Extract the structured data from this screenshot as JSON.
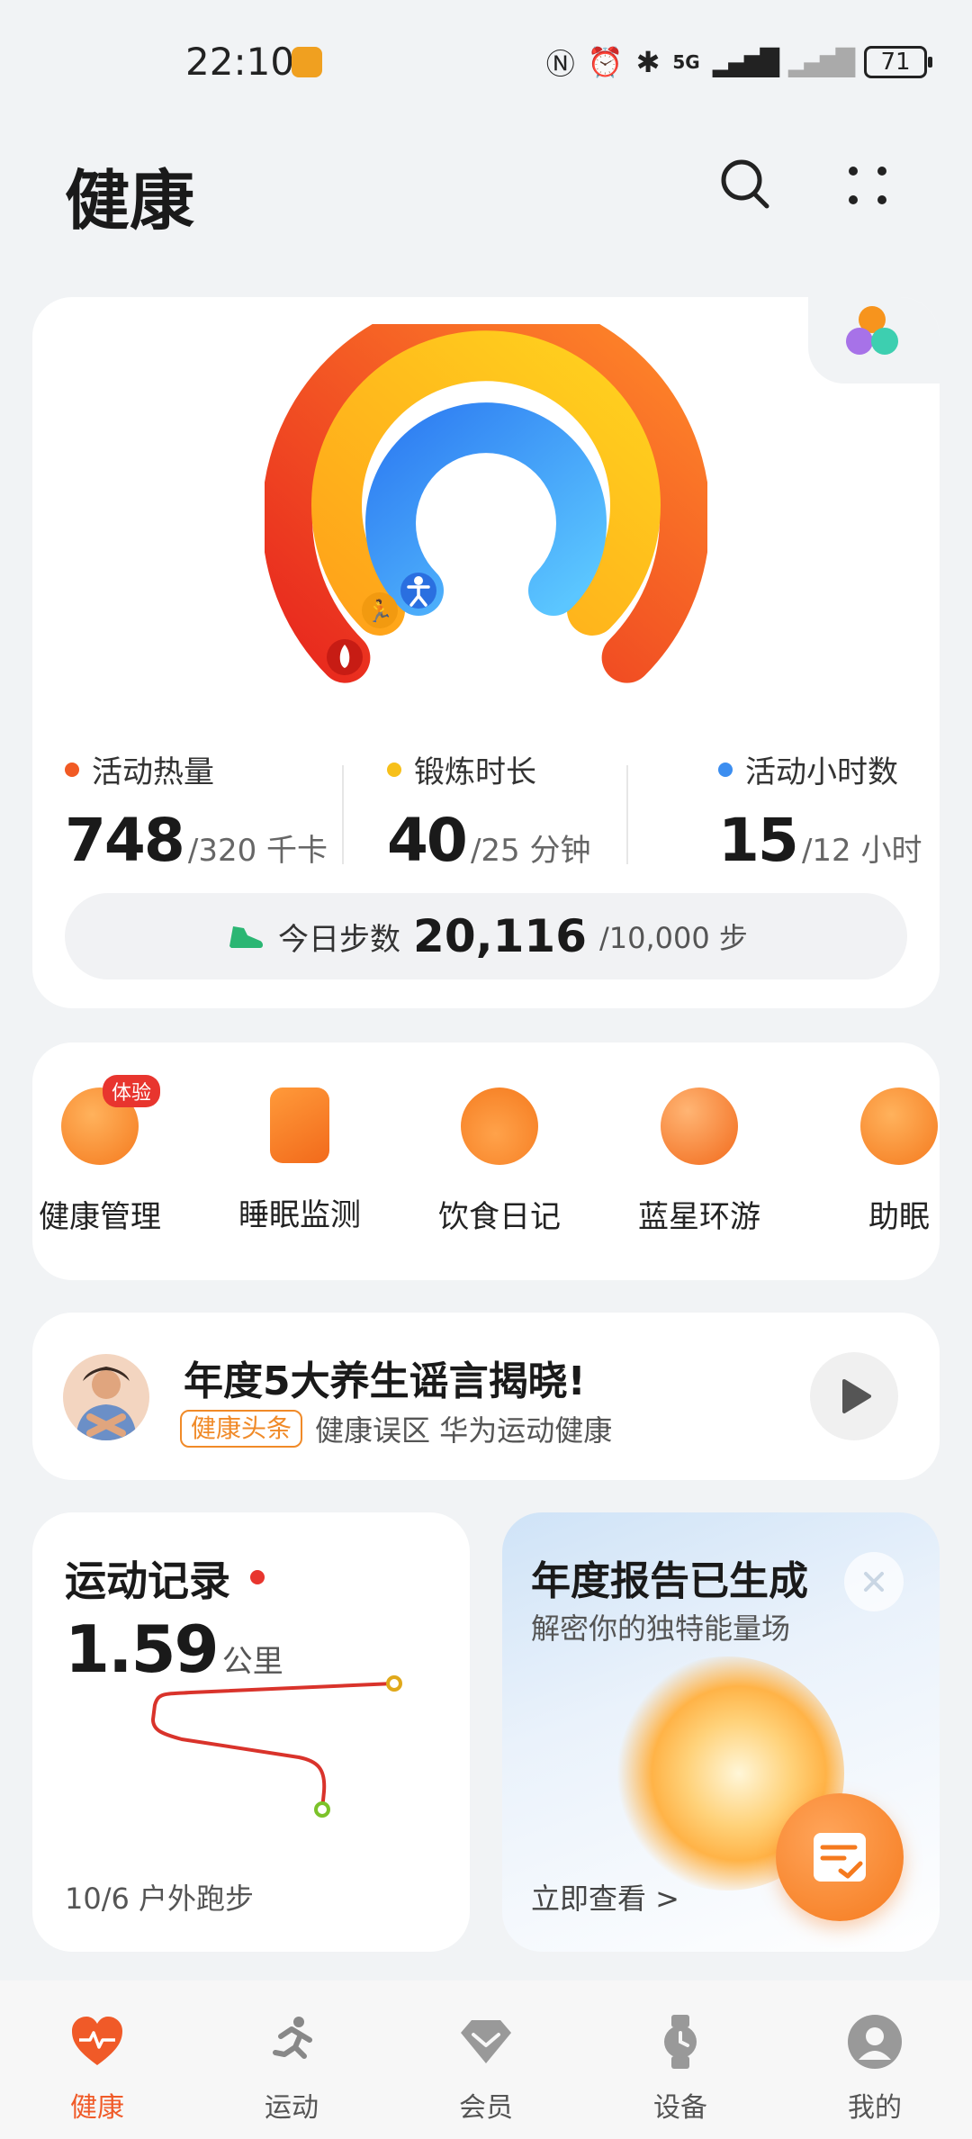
{
  "status_bar": {
    "time": "22:10",
    "net": "5G",
    "battery": "71"
  },
  "header": {
    "title": "健康"
  },
  "activity": {
    "stats": [
      {
        "label": "活动热量",
        "value": "748",
        "goal": "/320 千卡",
        "color": "#f15a24"
      },
      {
        "label": "锻炼时长",
        "value": "40",
        "goal": "/25 分钟",
        "color": "#f7c01a"
      },
      {
        "label": "活动小时数",
        "value": "15",
        "goal": "/12 小时",
        "color": "#3c8ef0"
      }
    ],
    "steps": {
      "label": "今日步数",
      "value": "20,116",
      "goal": "/10,000 步"
    }
  },
  "services": [
    {
      "name": "健康管理",
      "badge": "体验"
    },
    {
      "name": "睡眠监测"
    },
    {
      "name": "饮食日记"
    },
    {
      "name": "蓝星环游"
    },
    {
      "name": "助眠"
    }
  ],
  "headline": {
    "title": "年度5大养生谣言揭晓!",
    "tag": "健康头条",
    "meta": "健康误区 华为运动健康"
  },
  "record": {
    "title": "运动记录",
    "distance": "1.59",
    "unit": "公里",
    "footer": "10/6 户外跑步"
  },
  "report": {
    "title": "年度报告已生成",
    "subtitle": "解密你的独特能量场",
    "link": "立即查看 >"
  },
  "nav": [
    {
      "label": "健康",
      "active": true
    },
    {
      "label": "运动"
    },
    {
      "label": "会员"
    },
    {
      "label": "设备"
    },
    {
      "label": "我的"
    }
  ]
}
